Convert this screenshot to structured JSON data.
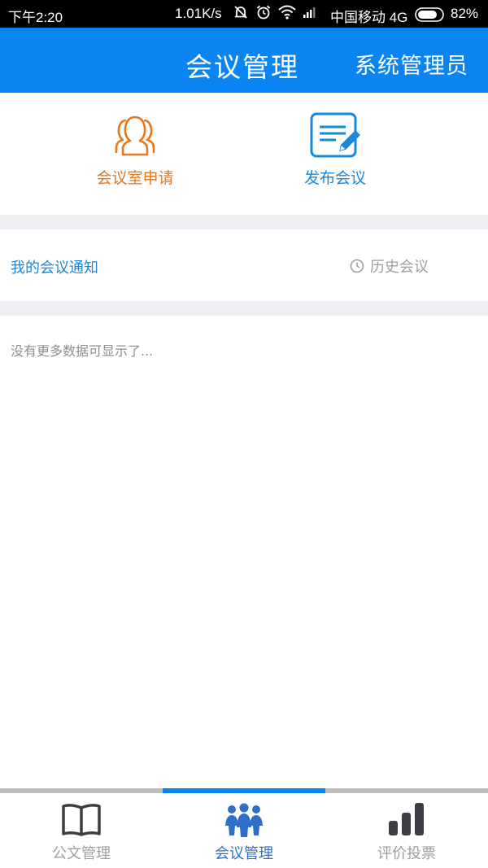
{
  "status_bar": {
    "time": "下午2:20",
    "speed": "1.01K/s",
    "carrier": "中国移动 4G",
    "battery_percent": "82%",
    "battery_level": 0.82
  },
  "header": {
    "title": "会议管理",
    "user": "系统管理员",
    "color": "#0a84f0"
  },
  "actions": [
    {
      "label": "会议室申请",
      "icon": "people-icon",
      "color": "#e8761a"
    },
    {
      "label": "发布会议",
      "icon": "edit-note-icon",
      "color": "#1a87d8"
    }
  ],
  "notices": {
    "title": "我的会议通知",
    "history_label": "历史会议",
    "empty_text": "没有更多数据可显示了..."
  },
  "bottom_nav": {
    "tabs": [
      {
        "label": "公文管理",
        "icon": "book-icon",
        "active": false
      },
      {
        "label": "会议管理",
        "icon": "meeting-icon",
        "active": true
      },
      {
        "label": "评价投票",
        "icon": "bar-chart-icon",
        "active": false
      }
    ]
  }
}
